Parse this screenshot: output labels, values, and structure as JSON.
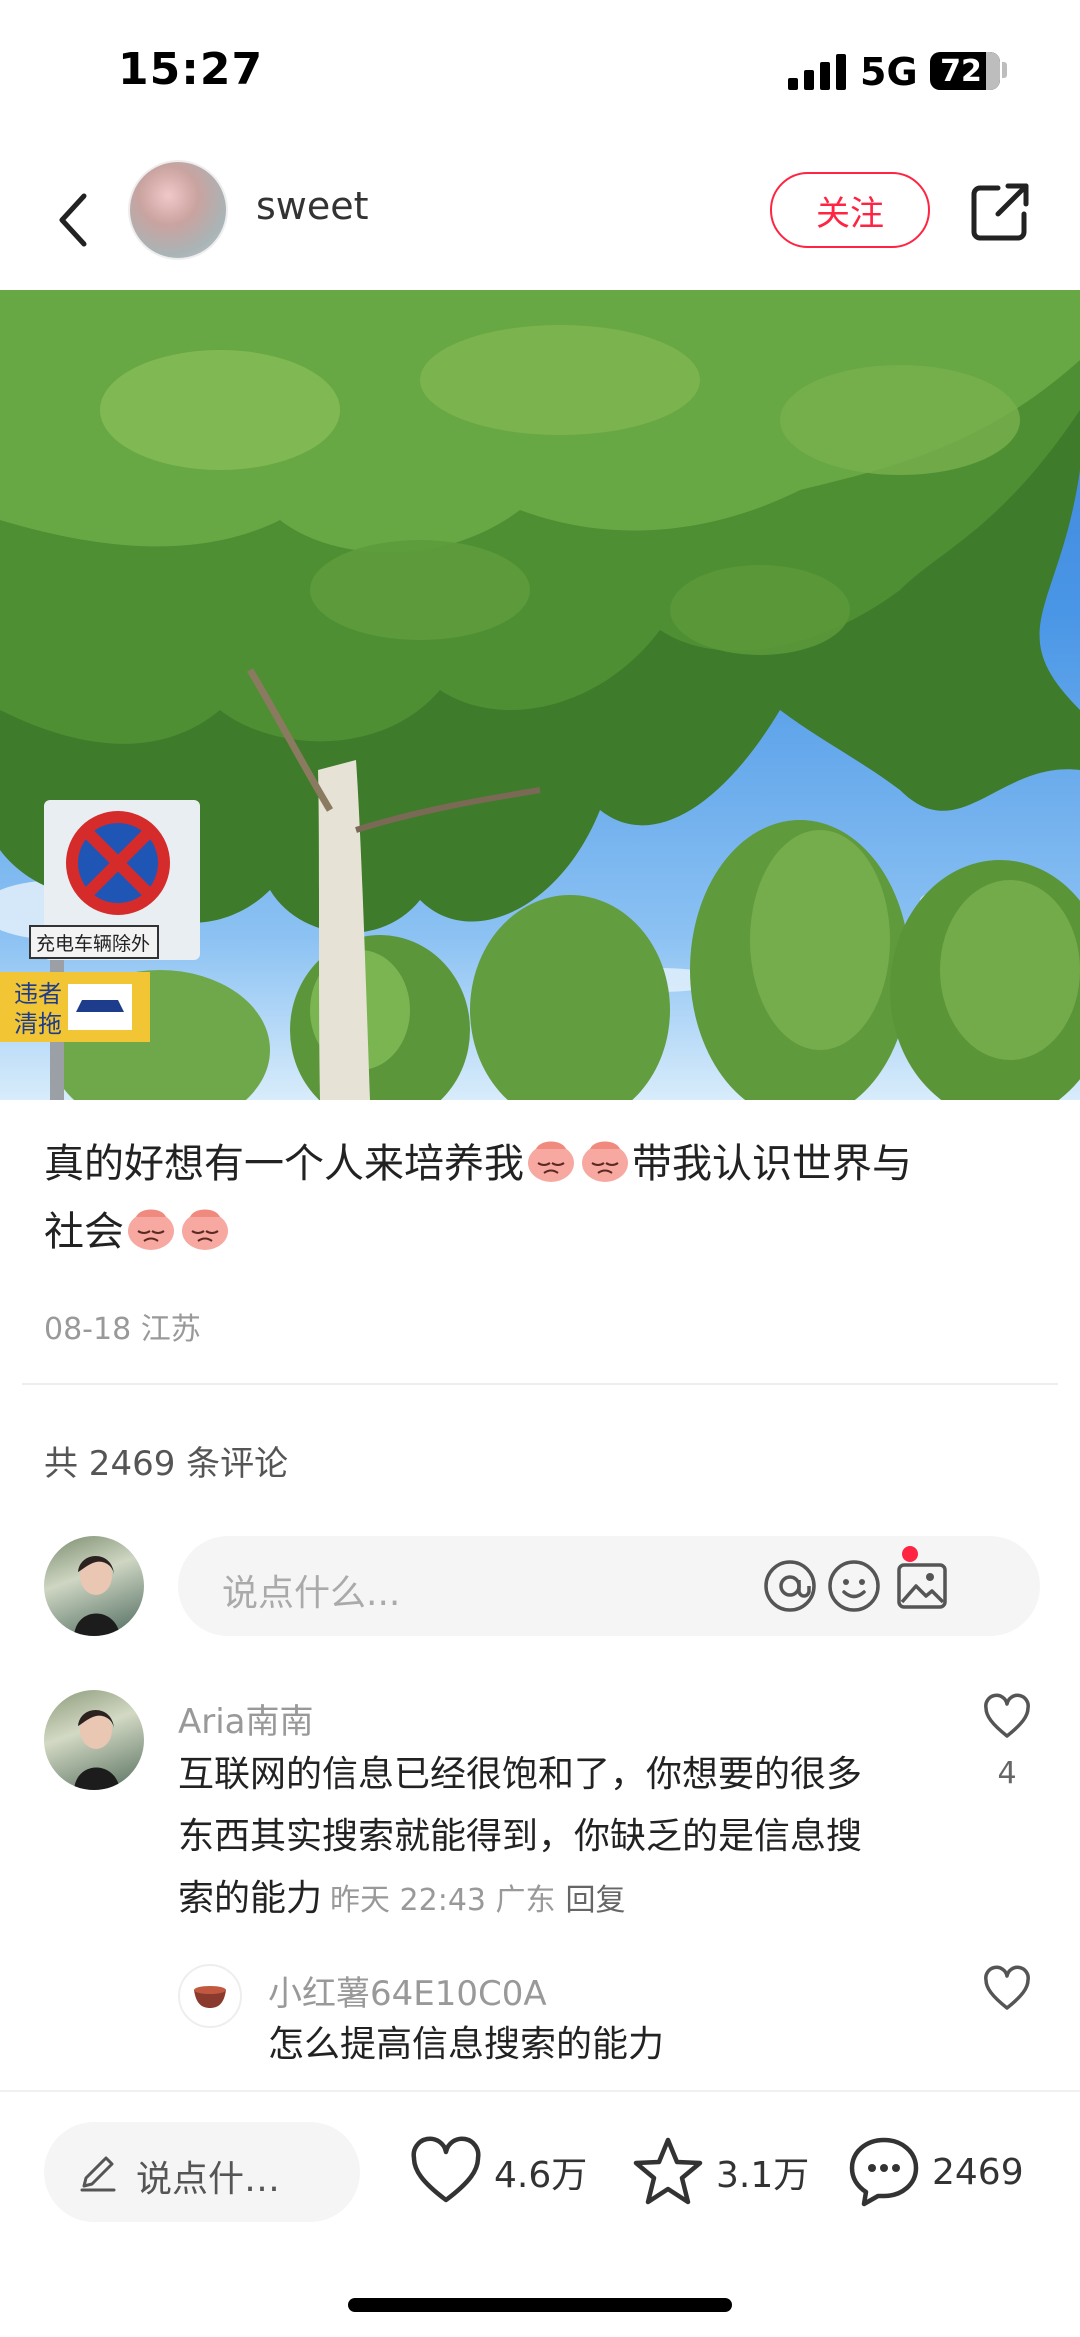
{
  "status_bar": {
    "time": "15:27",
    "network": "5G",
    "battery": "72"
  },
  "header": {
    "author_name": "sweet",
    "follow_label": "关注"
  },
  "post": {
    "caption_parts": [
      "真的好想有一个人来培养我",
      "带我认识世界与",
      "社会"
    ],
    "meta": "08-18 江苏"
  },
  "comments_section": {
    "count_label": "共 2469 条评论",
    "input_placeholder": "说点什么...",
    "comments": [
      {
        "user": "Aria南南",
        "text_lines": [
          "互联网的信息已经很饱和了，你想要的很多",
          "东西其实搜索就能得到，你缺乏的是信息搜",
          "索的能力"
        ],
        "time_location": "昨天 22:43 广东",
        "reply_label": "回复",
        "likes": "4"
      },
      {
        "user": "小红薯64E10C0A",
        "text": "怎么提高信息搜索的能力"
      }
    ]
  },
  "bottom_bar": {
    "input_placeholder": "说点什…",
    "likes": "4.6万",
    "collects": "3.1万",
    "comments": "2469"
  },
  "hero_sign": {
    "line1": "充电车辆除外",
    "line2a": "违者",
    "line2b": "清拖"
  },
  "colors": {
    "accent": "#ff2442",
    "text_primary": "#222222",
    "text_secondary": "#999999"
  },
  "icons": [
    "back-icon",
    "share-icon",
    "at-icon",
    "emoji-icon",
    "image-icon",
    "heart-icon",
    "star-icon",
    "comment-icon",
    "pen-icon"
  ]
}
